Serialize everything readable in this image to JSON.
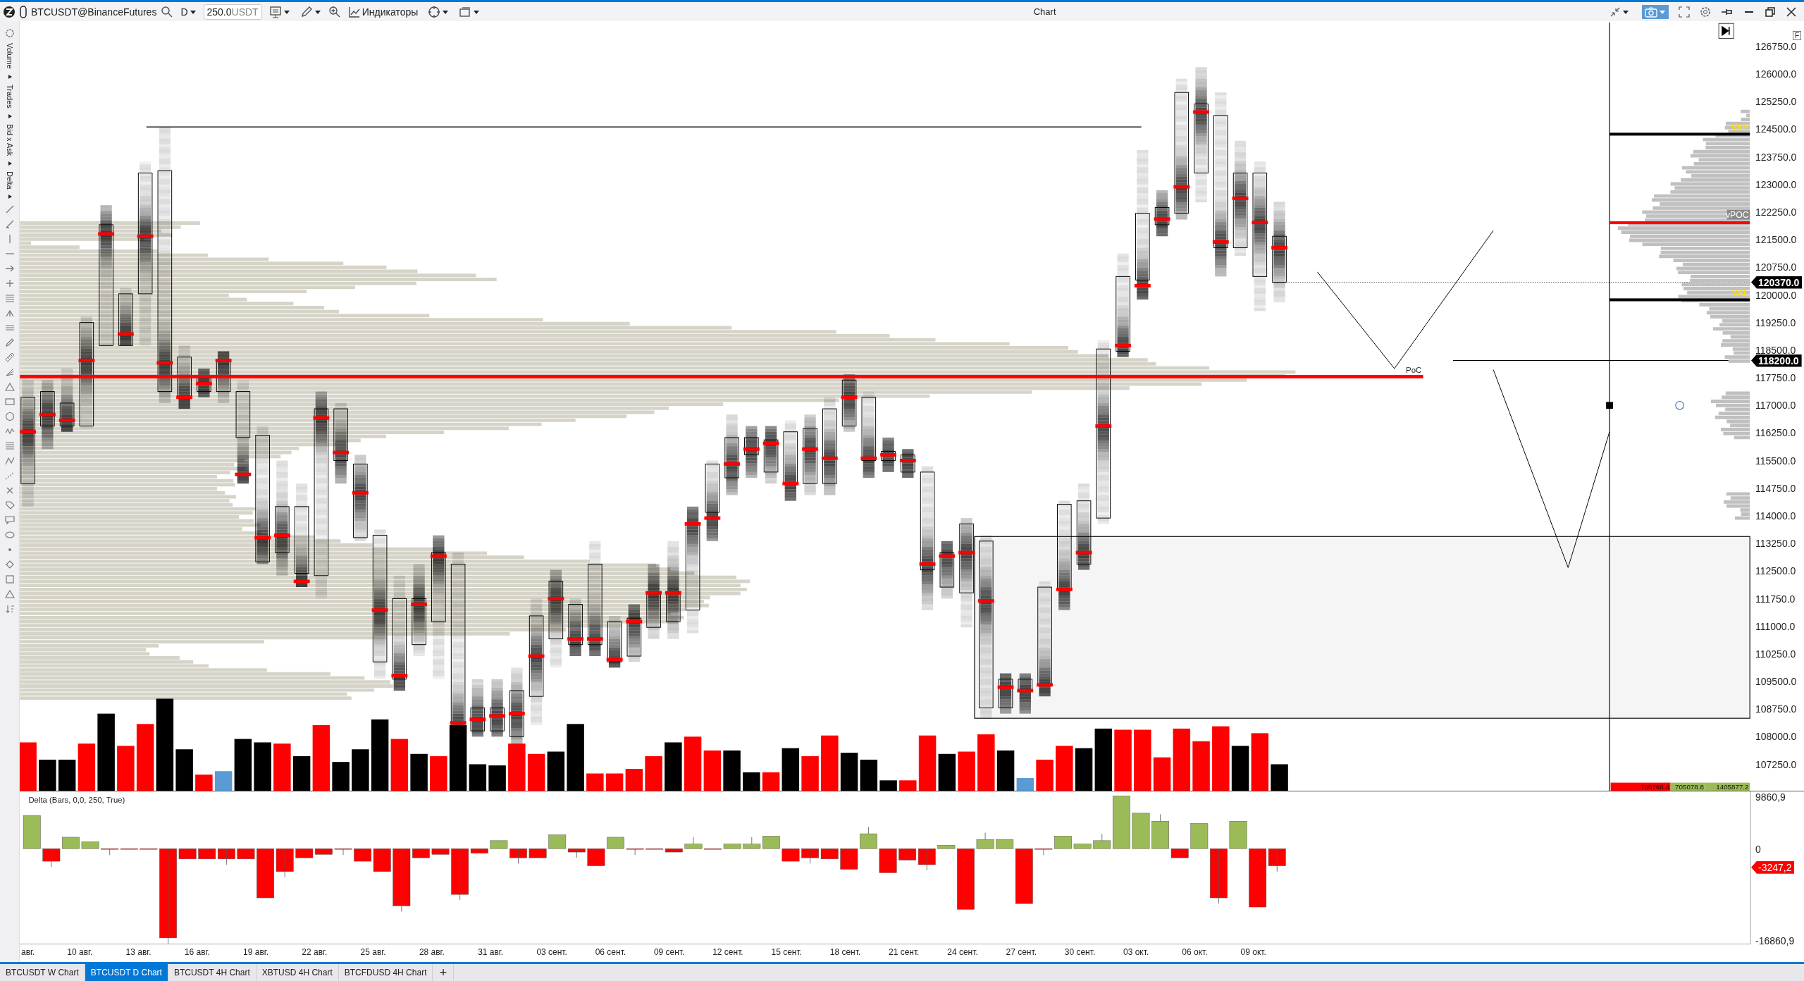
{
  "window": {
    "title": "Chart",
    "capture_selected": true
  },
  "toolbar": {
    "symbol": "BTCUSDT@BinanceFutures",
    "timeframe": "D",
    "quantity": "250.0",
    "quantity_unit": "USDT",
    "indicators": "Индикаторы"
  },
  "side_tools": {
    "labels": [
      "Volume",
      "Trades",
      "Bid x Ask",
      "Delta"
    ]
  },
  "price_chart": {
    "poc_label": "PoC",
    "axis_corner": "F",
    "price_ticks": [
      "126750.0",
      "126000.0",
      "125250.0",
      "124500.0",
      "123750.0",
      "123000.0",
      "122250.0",
      "121500.0",
      "120750.0",
      "120000.0",
      "119250.0",
      "118500.0",
      "117750.0",
      "117000.0",
      "116250.0",
      "115500.0",
      "114750.0",
      "114000.0",
      "113250.0",
      "112500.0",
      "111750.0",
      "111000.0",
      "110250.0",
      "109500.0",
      "108750.0",
      "108000.0",
      "107250.0"
    ],
    "last_price": "120370.0",
    "level_price": "118200.0"
  },
  "profile": {
    "vah": "VAH",
    "vpoc": "vPOC",
    "val": "VAL",
    "totals": [
      {
        "value": "700798.4",
        "color": "#ff0000"
      },
      {
        "value": "705078.8",
        "color": "#9bbb59"
      },
      {
        "value": "1405877.2",
        "color": "#9bbb59"
      }
    ]
  },
  "delta": {
    "title": "Delta (Bars, 0,0, 250, True)",
    "ticks": [
      "9860,9",
      "0",
      "-16860,9"
    ],
    "last_value": "-3247,2"
  },
  "dates": [
    "авг.",
    "10 авг.",
    "13 авг.",
    "16 авг.",
    "19 авг.",
    "22 авг.",
    "25 авг.",
    "28 авг.",
    "31 авг.",
    "03 сент.",
    "06 сент.",
    "09 сент.",
    "12 сент.",
    "15 сент.",
    "18 сент.",
    "21 сент.",
    "24 сент.",
    "27 сент.",
    "30 сент.",
    "03 окт.",
    "06 окт.",
    "09 окт."
  ],
  "tabs": [
    {
      "label": "BTCUSDT W Chart",
      "selected": false
    },
    {
      "label": "BTCUSDT D Chart",
      "selected": true
    },
    {
      "label": "BTCUSDT 4H Chart",
      "selected": false
    },
    {
      "label": "XBTUSD 4H Chart",
      "selected": false
    },
    {
      "label": "BTCFDUSD 4H Chart",
      "selected": false
    }
  ],
  "new_tab": "+"
}
